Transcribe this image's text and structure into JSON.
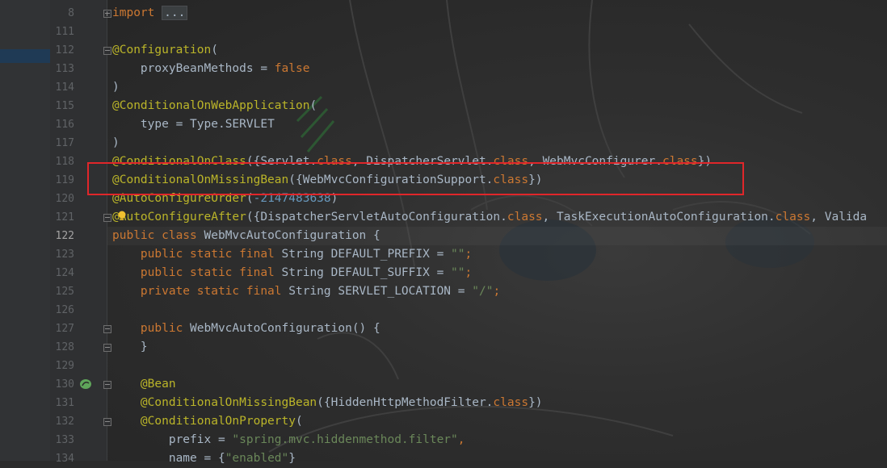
{
  "editor": {
    "highlight_color": "#e0262a",
    "lines": [
      {
        "num": "8",
        "fold": "plus",
        "segments": [
          {
            "c": "kw",
            "t": "import "
          },
          {
            "c": "folded",
            "t": "..."
          }
        ]
      },
      {
        "num": "111",
        "segments": []
      },
      {
        "num": "112",
        "fold": "minus",
        "segments": [
          {
            "c": "ann",
            "t": "@Configuration"
          },
          {
            "c": "plain",
            "t": "("
          }
        ]
      },
      {
        "num": "113",
        "segments": [
          {
            "c": "plain",
            "t": "    proxyBeanMethods = "
          },
          {
            "c": "kw",
            "t": "false"
          }
        ]
      },
      {
        "num": "114",
        "segments": [
          {
            "c": "plain",
            "t": ")"
          }
        ]
      },
      {
        "num": "115",
        "segments": [
          {
            "c": "ann",
            "t": "@ConditionalOnWebApplication"
          },
          {
            "c": "plain",
            "t": "("
          }
        ]
      },
      {
        "num": "116",
        "segments": [
          {
            "c": "plain",
            "t": "    type = Type."
          },
          {
            "c": "plain",
            "t": "SERVLET"
          }
        ]
      },
      {
        "num": "117",
        "segments": [
          {
            "c": "plain",
            "t": ")"
          }
        ]
      },
      {
        "num": "118",
        "segments": [
          {
            "c": "ann",
            "t": "@ConditionalOnClass"
          },
          {
            "c": "plain",
            "t": "({Servlet."
          },
          {
            "c": "kw",
            "t": "class"
          },
          {
            "c": "plain",
            "t": ", DispatcherServlet."
          },
          {
            "c": "kw",
            "t": "class"
          },
          {
            "c": "plain",
            "t": ", WebMvcConfigurer."
          },
          {
            "c": "kw",
            "t": "class"
          },
          {
            "c": "plain",
            "t": "})"
          }
        ]
      },
      {
        "num": "119",
        "segments": [
          {
            "c": "ann",
            "t": "@ConditionalOnMissingBean"
          },
          {
            "c": "plain",
            "t": "({WebMvcConfigurationSupport."
          },
          {
            "c": "kw",
            "t": "class"
          },
          {
            "c": "plain",
            "t": "})"
          }
        ]
      },
      {
        "num": "120",
        "segments": [
          {
            "c": "ann",
            "t": "@AutoConfigureOrder"
          },
          {
            "c": "plain",
            "t": "("
          },
          {
            "c": "num",
            "t": "-2147483638"
          },
          {
            "c": "plain",
            "t": ")"
          }
        ]
      },
      {
        "num": "121",
        "fold": "minus",
        "segments": [
          {
            "c": "ann",
            "t": "@AutoConfigureAfter"
          },
          {
            "c": "plain",
            "t": "({DispatcherServletAutoConfiguration."
          },
          {
            "c": "kw",
            "t": "class"
          },
          {
            "c": "plain",
            "t": ", TaskExecutionAutoConfiguration."
          },
          {
            "c": "kw",
            "t": "class"
          },
          {
            "c": "plain",
            "t": ", Valida"
          }
        ]
      },
      {
        "num": "122",
        "current": true,
        "segments": [
          {
            "c": "kw",
            "t": "public class "
          },
          {
            "c": "plain",
            "t": "WebMvcAutoConfiguration {"
          }
        ]
      },
      {
        "num": "123",
        "segments": [
          {
            "c": "plain",
            "t": "    "
          },
          {
            "c": "kw",
            "t": "public static final "
          },
          {
            "c": "plain",
            "t": "String DEFAULT_PREFIX = "
          },
          {
            "c": "str",
            "t": "\"\""
          },
          {
            "c": "kw",
            "t": ";"
          }
        ]
      },
      {
        "num": "124",
        "segments": [
          {
            "c": "plain",
            "t": "    "
          },
          {
            "c": "kw",
            "t": "public static final "
          },
          {
            "c": "plain",
            "t": "String DEFAULT_SUFFIX = "
          },
          {
            "c": "str",
            "t": "\"\""
          },
          {
            "c": "kw",
            "t": ";"
          }
        ]
      },
      {
        "num": "125",
        "segments": [
          {
            "c": "plain",
            "t": "    "
          },
          {
            "c": "kw",
            "t": "private static final "
          },
          {
            "c": "plain",
            "t": "String SERVLET_LOCATION = "
          },
          {
            "c": "str",
            "t": "\"/\""
          },
          {
            "c": "kw",
            "t": ";"
          }
        ]
      },
      {
        "num": "126",
        "segments": []
      },
      {
        "num": "127",
        "fold": "minus",
        "segments": [
          {
            "c": "plain",
            "t": "    "
          },
          {
            "c": "kw",
            "t": "public "
          },
          {
            "c": "plain",
            "t": "WebMvcAutoConfiguration() {"
          }
        ]
      },
      {
        "num": "128",
        "fold": "minus",
        "segments": [
          {
            "c": "plain",
            "t": "    }"
          }
        ]
      },
      {
        "num": "129",
        "segments": []
      },
      {
        "num": "130",
        "icon": "spring-bean-icon",
        "fold": "minus",
        "segments": [
          {
            "c": "plain",
            "t": "    "
          },
          {
            "c": "ann",
            "t": "@Bean"
          }
        ]
      },
      {
        "num": "131",
        "segments": [
          {
            "c": "plain",
            "t": "    "
          },
          {
            "c": "ann",
            "t": "@ConditionalOnMissingBean"
          },
          {
            "c": "plain",
            "t": "({HiddenHttpMethodFilter."
          },
          {
            "c": "kw",
            "t": "class"
          },
          {
            "c": "plain",
            "t": "})"
          }
        ]
      },
      {
        "num": "132",
        "fold": "minus",
        "segments": [
          {
            "c": "plain",
            "t": "    "
          },
          {
            "c": "ann",
            "t": "@ConditionalOnProperty"
          },
          {
            "c": "plain",
            "t": "("
          }
        ]
      },
      {
        "num": "133",
        "segments": [
          {
            "c": "plain",
            "t": "        prefix = "
          },
          {
            "c": "str",
            "t": "\"spring.mvc.hiddenmethod.filter\""
          },
          {
            "c": "kw",
            "t": ","
          }
        ]
      },
      {
        "num": "134",
        "segments": [
          {
            "c": "plain",
            "t": "        name = {"
          },
          {
            "c": "str",
            "t": "\"enabled\""
          },
          {
            "c": "plain",
            "t": "}"
          }
        ]
      }
    ]
  }
}
